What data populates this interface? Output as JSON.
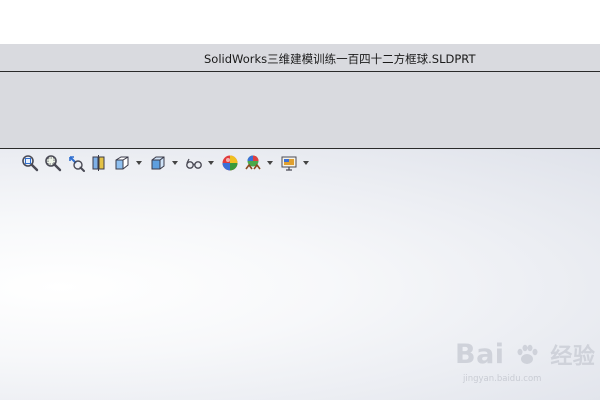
{
  "window": {
    "title": "SolidWorks三维建模训练一百四十二方框球.SLDPRT"
  },
  "heads_up_toolbar": {
    "tools": [
      {
        "icon": "zoom-to-fit-icon"
      },
      {
        "icon": "zoom-to-area-icon"
      },
      {
        "icon": "previous-view-icon"
      },
      {
        "icon": "section-view-icon"
      },
      {
        "icon": "view-orientation-icon",
        "has_dropdown": true
      },
      {
        "icon": "display-style-icon",
        "has_dropdown": true
      },
      {
        "icon": "hide-show-items-icon",
        "has_dropdown": true
      },
      {
        "icon": "edit-appearance-icon"
      },
      {
        "icon": "apply-scene-icon",
        "has_dropdown": true
      },
      {
        "icon": "view-settings-icon",
        "has_dropdown": true
      }
    ]
  },
  "watermark": {
    "brand_part1": "Bai",
    "brand_part2": "经验",
    "url": "jingyan.baidu.com"
  },
  "colors": {
    "titlebar_bg": "#d9dadf",
    "viewport_edge": "#dfe2ea"
  }
}
